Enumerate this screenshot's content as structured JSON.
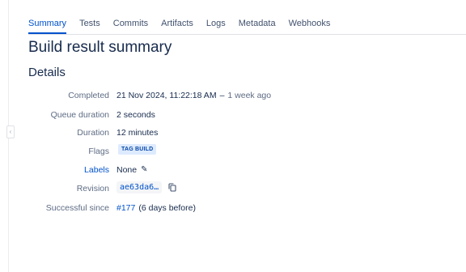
{
  "tabs": [
    {
      "label": "Summary"
    },
    {
      "label": "Tests"
    },
    {
      "label": "Commits"
    },
    {
      "label": "Artifacts"
    },
    {
      "label": "Logs"
    },
    {
      "label": "Metadata"
    },
    {
      "label": "Webhooks"
    }
  ],
  "active_tab": "Summary",
  "page_title": "Build result summary",
  "section_title": "Details",
  "details": {
    "completed": {
      "label": "Completed",
      "value": "21 Nov 2024, 11:22:18 AM",
      "separator": "–",
      "relative": "1 week ago"
    },
    "queue_duration": {
      "label": "Queue duration",
      "value": "2 seconds"
    },
    "duration": {
      "label": "Duration",
      "value": "12 minutes"
    },
    "flags": {
      "label": "Flags",
      "badge": "TAG BUILD"
    },
    "labels": {
      "label": "Labels",
      "value": "None"
    },
    "revision": {
      "label": "Revision",
      "value": "ae63da6…"
    },
    "successful_since": {
      "label": "Successful since",
      "build_link": "#177",
      "note": "(6 days before)"
    }
  },
  "icons": {
    "edit": "pencil-icon",
    "copy": "copy-icon",
    "sidebar_toggle": "chevron-left-icon"
  },
  "colors": {
    "link": "#0052cc",
    "text": "#172b4d",
    "muted": "#5e6c84",
    "badge_bg": "#deebff",
    "badge_text": "#0747a6"
  }
}
